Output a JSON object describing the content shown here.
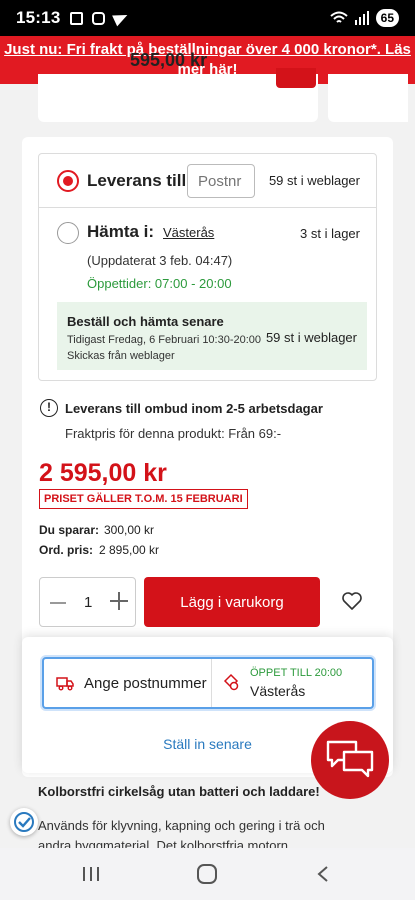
{
  "statusbar": {
    "time": "15:13",
    "battery": "65"
  },
  "promo": {
    "text": "Just nu: Fri frakt på beställningar över 4 000 kronor*. Läs mer här!"
  },
  "top_card": {
    "price_partial": "595,00 kr"
  },
  "delivery": {
    "option_delivery_label": "Leverans till:",
    "postnr_placeholder": "Postnr",
    "delivery_stock": "59 st i weblager",
    "option_pickup_label": "Hämta i:",
    "pickup_store": "Västerås",
    "pickup_stock": "3 st i lager",
    "updated": "(Uppdaterat 3 feb. 04:47)",
    "opening_hours": "Öppettider: 07:00 - 20:00",
    "pickup_later": {
      "title": "Beställ och hämta senare",
      "date": "Tidigast Fredag, 6 Februari 10:30-20:00",
      "ships_from": "Skickas från weblager",
      "stock": "59 st i weblager"
    },
    "selected_option": "delivery"
  },
  "shipping_info": {
    "title": "Leverans till ombud inom 2-5 arbetsdagar",
    "freight": "Fraktpris för denna produkt: Från 69:-"
  },
  "pricing": {
    "price": "2 595,00 kr",
    "valid_badge": "PRISET GÄLLER T.O.M. 15 FEBRUARI",
    "save_label": "Du sparar:",
    "save_value": "300,00 kr",
    "ord_label": "Ord. pris:",
    "ord_value": "2 895,00 kr"
  },
  "cart": {
    "quantity": "1",
    "add_label": "Lägg i varukorg"
  },
  "store_selector": {
    "postcode_label": "Ange postnummer",
    "open_status": "ÖPPET TILL 20:00",
    "store": "Västerås",
    "later_link": "Ställ in senare"
  },
  "description": {
    "title": "Kolborstfri cirkelsåg utan batteri och laddare!",
    "body": "Används för klyvning, kapning och gering i trä och andra byggmaterial. Det kolborstfria motorn"
  },
  "colors": {
    "brand_red": "#d31219",
    "promo_red": "#e11a22",
    "open_green": "#2c9a3c",
    "link_blue": "#2a7abf"
  },
  "icons": [
    "qr-icon",
    "nfc-icon",
    "telegram-icon",
    "wifi-icon",
    "signal-icon",
    "info-icon",
    "heart-icon",
    "truck-icon",
    "store-icon",
    "chat-icon",
    "check-badge-icon",
    "recent-apps-icon",
    "home-icon",
    "back-icon"
  ]
}
